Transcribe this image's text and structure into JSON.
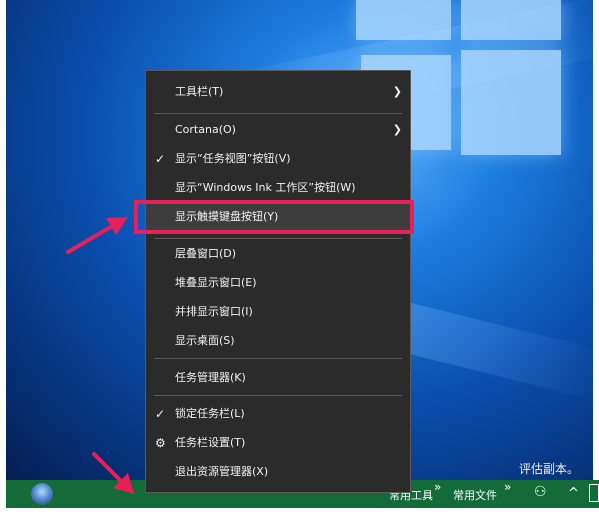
{
  "menu": {
    "items": [
      {
        "label": "工具栏(T)",
        "checked": false,
        "submenu": true
      },
      {
        "label": "Cortana(O)",
        "checked": false,
        "submenu": true
      },
      {
        "label": "显示“任务视图”按钮(V)",
        "checked": true,
        "submenu": false
      },
      {
        "label": "显示“Windows Ink 工作区”按钮(W)",
        "checked": false,
        "submenu": false
      },
      {
        "label": "显示触摸键盘按钮(Y)",
        "checked": false,
        "submenu": false
      },
      {
        "label": "层叠窗口(D)",
        "checked": false,
        "submenu": false
      },
      {
        "label": "堆叠显示窗口(E)",
        "checked": false,
        "submenu": false
      },
      {
        "label": "并排显示窗口(I)",
        "checked": false,
        "submenu": false
      },
      {
        "label": "显示桌面(S)",
        "checked": false,
        "submenu": false
      },
      {
        "label": "任务管理器(K)",
        "checked": false,
        "submenu": false
      },
      {
        "label": "锁定任务栏(L)",
        "checked": true,
        "submenu": false
      },
      {
        "label": "任务栏设置(T)",
        "checked": false,
        "submenu": false,
        "icon": "gear-icon"
      },
      {
        "label": "退出资源管理器(X)",
        "checked": false,
        "submenu": false
      }
    ],
    "check_glyph": "✓",
    "arrow_glyph": "❯",
    "gear_glyph": "⚙"
  },
  "desktop": {
    "watermark": "评估副本。"
  },
  "taskbar": {
    "toolbar_1": "常用工具",
    "toolbar_2": "常用文件",
    "overflow_glyph": "»",
    "chevron_glyph": "^",
    "people_glyph": "⚇"
  },
  "colors": {
    "highlight": "#e8205a",
    "taskbar": "#136b38",
    "menu_bg": "#2b2b2b"
  }
}
